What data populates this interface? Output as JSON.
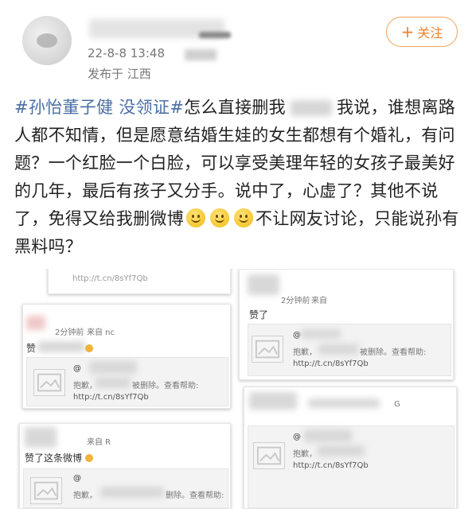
{
  "header": {
    "date": "22-8-8 13:48",
    "region": "发布于 江西",
    "follow_label": "关注",
    "follow_icon": "plus-icon",
    "accent_color": "#e8802c"
  },
  "post": {
    "hashtag": "#孙怡董子健 没领证#",
    "text_part1": "怎么直接删我",
    "text_part2": "我说，谁想离路人都不知情，但是愿意结婚生娃的女生都想有个婚礼，有问题？一个红脸一个白脸，可以享受美理年轻的女孩子最美好的几年，最后有孩子又分手。说中了，心虚了？其他不说了，免得又给我删微博",
    "text_part3": "不让网友讨论，只能说孙有黑料吗？",
    "emoji_name": "smile-emoji",
    "hashtag_color": "#4a6fa5"
  },
  "screenshots": {
    "s1": {
      "link_top": "http://t.cn/8sYf7Qb"
    },
    "s2": {
      "time": "2分钟前",
      "source": "来自",
      "comment": "赞了",
      "at": "@",
      "notice": "抱歉，",
      "notice2": "被删除。查看帮助:",
      "link": "http://t.cn/8sYf7Qb"
    },
    "s3": {
      "time": "2分钟前",
      "source": "来自 nc",
      "comment": "赞",
      "at": "@",
      "notice": "抱歉，",
      "notice2": "被删除。查看帮助:",
      "link": "http://t.cn/8sYf7Qb"
    },
    "s4": {
      "at": "@",
      "notice": "抱歉，",
      "link": "http://t.cn/8sYf7Qb",
      "tag": "G"
    },
    "s5": {
      "source": "来自 R",
      "comment": "赞了这条微博",
      "at": "@",
      "notice": "抱歉，",
      "notice2": "删除。查看帮助:"
    }
  }
}
